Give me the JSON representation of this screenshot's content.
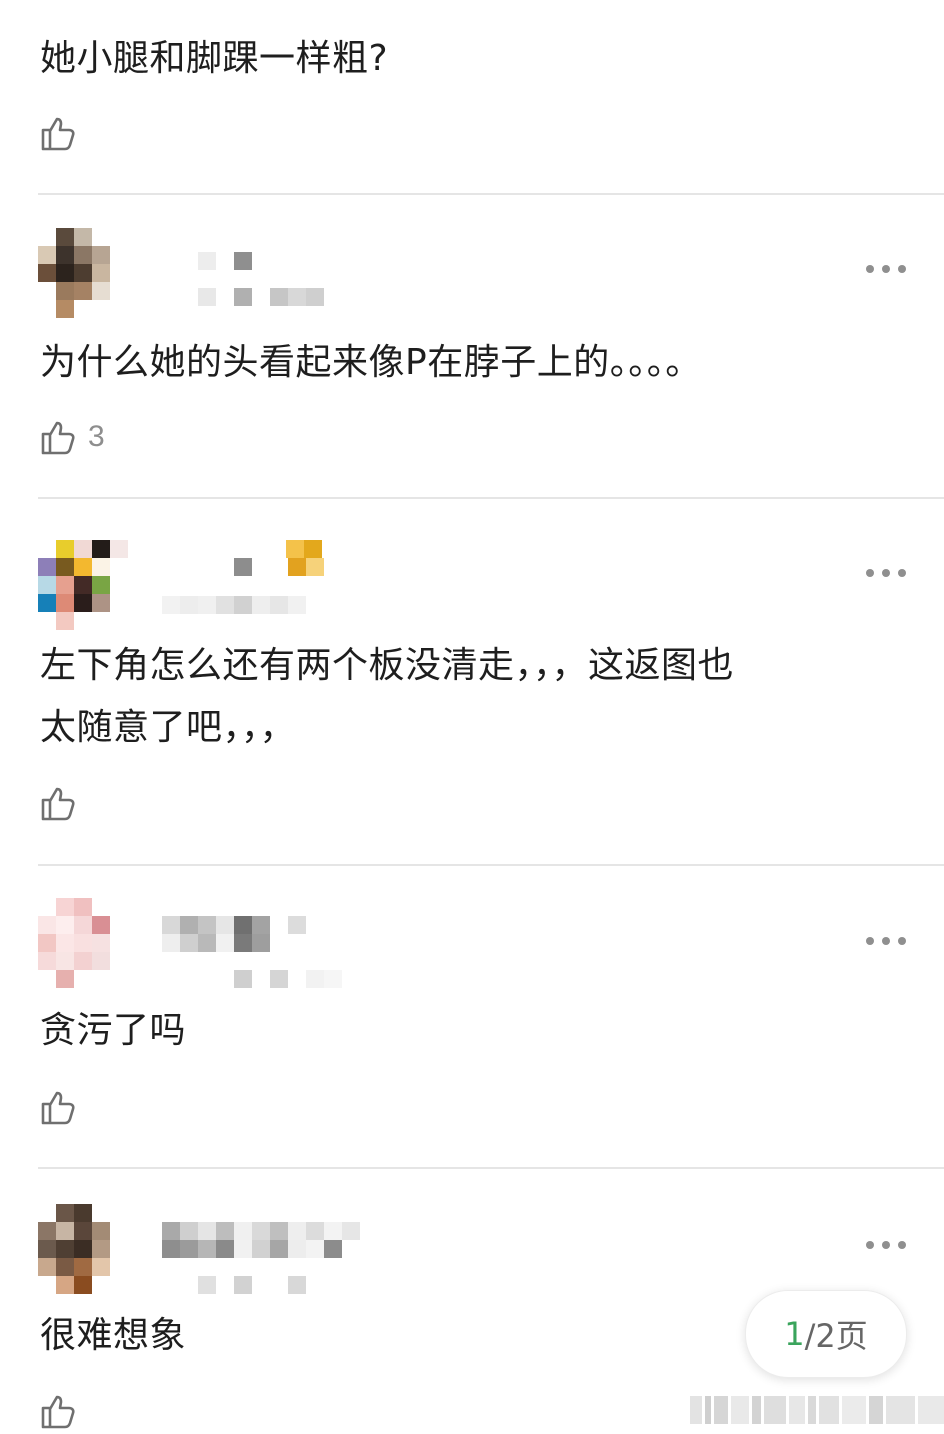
{
  "comments": [
    {
      "text": "她小腿和脚踝一样粗?",
      "likes": ""
    },
    {
      "text": "为什么她的头看起来像P在脖子上的。。。。",
      "likes": "3"
    },
    {
      "text": "左下角怎么还有两个板没清走，，，这返图也\n太随意了吧，，，",
      "likes": ""
    },
    {
      "text": "贪污了吗",
      "likes": ""
    },
    {
      "text": "很难想象",
      "likes": ""
    }
  ],
  "pager": {
    "current": "1",
    "rest": "/2页"
  },
  "icons": {
    "like": "thumbs-up-icon",
    "more": "more-dots-icon"
  },
  "colors": {
    "text": "#1e1e1e",
    "meta": "#8e8e8e",
    "divider": "#e5e5e5",
    "accent": "#3aa45c"
  }
}
